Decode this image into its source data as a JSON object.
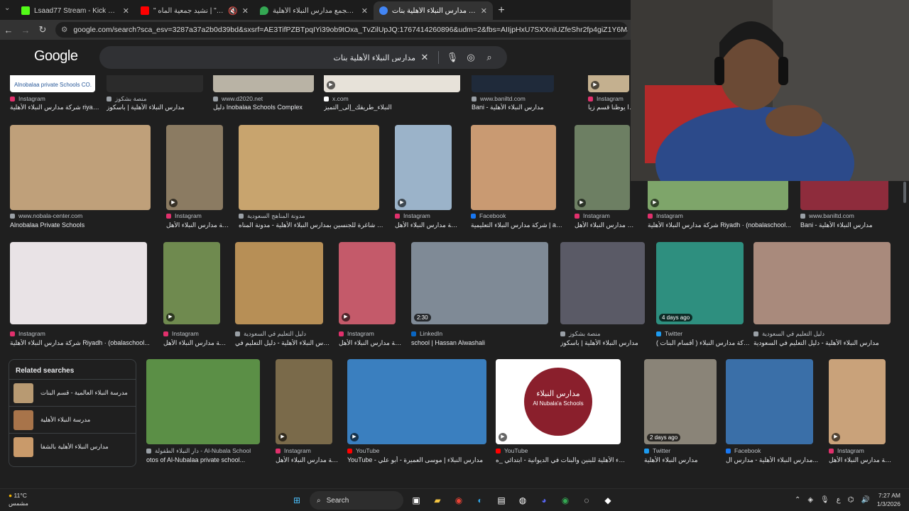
{
  "browser": {
    "tabs": [
      {
        "title": "Lsaad77 Stream - Kick Dashboa",
        "color": "#53fc18"
      },
      {
        "title": "\" الماهر \" | نشيد جمعية الماه",
        "color": "#ff0000"
      },
      {
        "title": "مجمع مدارس النبلاء الأهلية - aps",
        "color": "#34a853"
      },
      {
        "title": "مدارس النبلاء الأهلية بنات - arch",
        "color": "#4285f4"
      }
    ],
    "new_tab": "+",
    "url": "google.com/search?sca_esv=3287a37a2b0d39bd&sxsrf=AE3TifPZBTpqIYi39ob9tOxa_TvZilUpJQ:1767414260896&udm=2&fbs=AIIjpHxU7SXXniUZfeShr2fp4giZ1Y6MJ25_tmWITc7uy4KIetxLMe"
  },
  "google": {
    "logo": "Google",
    "query": "مدارس النبلاء الأهلية بنات"
  },
  "results": [
    {
      "row": 0,
      "source": "Instagram",
      "caption": "شركة مدارس النبلاء الأهلية riyadh...",
      "thumb": "#ffffff",
      "overlay": "Alnobalaa private Schools CO."
    },
    {
      "row": 0,
      "source": "منصة بشكوز",
      "caption": "مدارس النبلاء الأهلية | باسكوز",
      "thumb": "#2b2b2b"
    },
    {
      "row": 0,
      "source": "www.d2020.net",
      "caption": "دليل Inobalaa Schools Complex",
      "thumb": "#b9b3a5"
    },
    {
      "row": 0,
      "source": "x.com",
      "caption": "النبلاء_طريقك_إلى_التميز",
      "thumb": "#e7e2d9",
      "play": true
    },
    {
      "row": 0,
      "source": "www.baniltd.com",
      "caption": "Bani - مدارس النبلاء الأهلية",
      "thumb": "#1f2a3a"
    },
    {
      "row": 0,
      "source": "Instagram",
      "caption": "نزا يوظنا قسم زيا...",
      "thumb": "#c4b08f",
      "play": true
    },
    {
      "row": 1,
      "source": "www.nobala-center.com",
      "caption": "Alnobalaa Private Schools",
      "thumb": "#bfa07a"
    },
    {
      "row": 1,
      "source": "Instagram",
      "caption": "شركة مدارس النبلاء الأهل...",
      "thumb": "#8b7b62",
      "play": true
    },
    {
      "row": 1,
      "source": "مدونة المناهج السعودية",
      "caption": "وظائف شاغرة للجنسين بمدارس النبلاء الأهلية - مدونة المناه...",
      "thumb": "#c8a46e"
    },
    {
      "row": 1,
      "source": "Instagram",
      "caption": "شركة مدارس النبلاء الأهل...",
      "thumb": "#9bb3c9",
      "play": true
    },
    {
      "row": 1,
      "source": "Facebook",
      "caption": "شركة مدارس النبلاء التعليمية | adh...",
      "thumb": "#c99a72"
    },
    {
      "row": 1,
      "source": "Instagram",
      "caption": "شركة مدارس النبلاء الأهل...",
      "thumb": "#6d7f63",
      "play": true
    },
    {
      "row": 1,
      "source": "Instagram",
      "caption": "شركة مدارس النبلاء الأهلية Riyadh · (nobalaschool...",
      "thumb": "#7ea56a",
      "play": true
    },
    {
      "row": 1,
      "source": "www.baniltd.com",
      "caption": "Bani - مدارس النبلاء الأهلية",
      "thumb": "#8e2c3c"
    },
    {
      "row": 2,
      "source": "Instagram",
      "caption": "شركة مدارس النبلاء الأهلية Riyadh · (obalaschool...",
      "thumb": "#e9e3e6"
    },
    {
      "row": 2,
      "source": "Instagram",
      "caption": "شركة مدارس النبلاء الأهل...",
      "thumb": "#6f8a4f",
      "play": true
    },
    {
      "row": 2,
      "source": "دليل التعليم في السعودية",
      "caption": "مدارس النبلاء الأهلية - دليل التعليم في...",
      "thumb": "#b78f56"
    },
    {
      "row": 2,
      "source": "Instagram",
      "caption": "شركة مدارس النبلاء الأهل...",
      "thumb": "#c45a6a",
      "play": true
    },
    {
      "row": 2,
      "source": "LinkedIn",
      "caption": "school | Hassan Alwashali",
      "thumb": "#7f8a96",
      "badge": "2:30"
    },
    {
      "row": 2,
      "source": "منصة بشكوز",
      "caption": "مدارس النبلاء الأهلية | باسكوز",
      "thumb": "#5a5a66"
    },
    {
      "row": 2,
      "source": "Twitter",
      "caption": "شركة مدارس النبلاء ( أقسام البنات )",
      "thumb": "#2e8f7f",
      "badge": "4 days ago"
    },
    {
      "row": 2,
      "source": "دليل التعليم في السعودية",
      "caption": "مدارس النبلاء الأهلية - دليل التعليم في السعودية",
      "thumb": "#a98a7c"
    },
    {
      "row": 3,
      "source": "دار النبلاء الطفولة - Al-Nubala School",
      "caption": "otos of Al-Nubalaa private school...",
      "thumb": "#5b8f46"
    },
    {
      "row": 3,
      "source": "Instagram",
      "caption": "شركة مدارس النبلاء الأهل...",
      "thumb": "#7a6a4a",
      "play": true
    },
    {
      "row": 3,
      "source": "YouTube",
      "caption": "YouTube - مدارس النبلاء | موسى العميرة - أبو علي",
      "thumb": "#3a7fbf",
      "play": true
    },
    {
      "row": 3,
      "source": "YouTube",
      "caption": "مدارس النبلاء الأهلية للبنين والبنات في الديوانية - ابتدائي _ه...",
      "thumb": "#ffffff",
      "play": true,
      "logo_ar": "مدارس النبلاء",
      "logo_en": "Al Nubala'a Schools"
    },
    {
      "row": 3,
      "source": "Twitter",
      "caption": "مدارس النبلاء الأهلية",
      "thumb": "#8a8478",
      "badge": "2 days ago"
    },
    {
      "row": 3,
      "source": "Facebook",
      "caption": "مدارس النبلاء الأهلية - مدارس ال...",
      "thumb": "#3a6fa8"
    },
    {
      "row": 3,
      "source": "Instagram",
      "caption": "شركة مدارس النبلاء الأهل...",
      "thumb": "#c9a27a",
      "play": true
    }
  ],
  "related": {
    "title": "Related searches",
    "items": [
      {
        "label": "مدرسة النبلاء العالمية - قسم البنات",
        "thumb": "#b89a72"
      },
      {
        "label": "مدرسة النبلاء الأهلية",
        "thumb": "#a8744a"
      },
      {
        "label": "مدارس النبلاء الأهلية بالشفا",
        "thumb": "#c99a6a"
      }
    ]
  },
  "taskbar": {
    "temp": "11°C",
    "weather": "مشمس",
    "search": "Search",
    "lang": "ع",
    "time": "7:27 AM",
    "date": "1/3/2026"
  }
}
